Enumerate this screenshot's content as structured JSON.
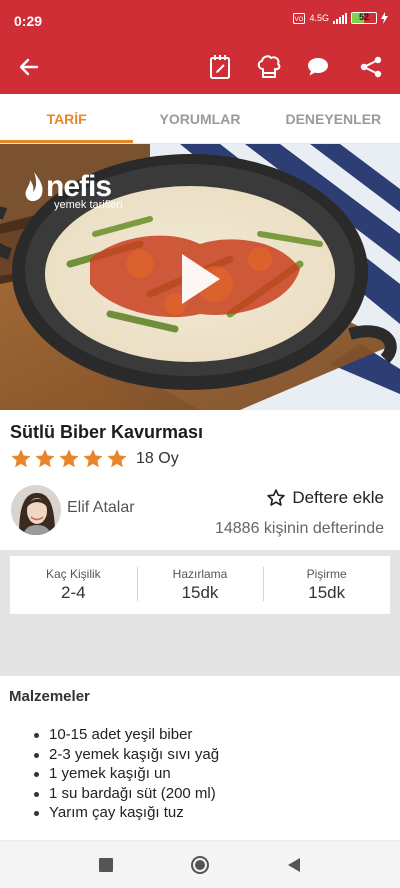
{
  "status_bar": {
    "time": "0:29",
    "network_type": "4.5G",
    "battery_level": "52",
    "battery_fraction": 0.52,
    "icons": [
      "volte-icon",
      "signal-icon",
      "battery-icon",
      "charging-icon"
    ]
  },
  "toolbar": {
    "icons": [
      "back-arrow-icon",
      "notebook-edit-icon",
      "chef-hat-icon",
      "comment-icon",
      "share-icon"
    ],
    "accent_color": "#cf2e36"
  },
  "tabs": [
    {
      "label": "TARİF",
      "active": true
    },
    {
      "label": "YORUMLAR",
      "active": false
    },
    {
      "label": "DENEYENLER",
      "active": false
    }
  ],
  "tab_accent": "#e8862a",
  "video": {
    "logo_text": "nefis",
    "logo_subtext": "yemek tarifleri",
    "play_icon": "play-icon"
  },
  "recipe": {
    "title": "Sütlü Biber Kavurması",
    "rating_stars": 5,
    "rating_count": "18 Oy",
    "star_color": "#e8862a",
    "author": "Elif Atalar",
    "add_to_notebook": "Deftere ekle",
    "notebook_count": "14886 kişinin defterinde"
  },
  "stats": [
    {
      "label": "Kaç Kişilik",
      "value": "2-4"
    },
    {
      "label": "Hazırlama",
      "value": "15dk"
    },
    {
      "label": "Pişirme",
      "value": "15dk"
    }
  ],
  "ingredients": {
    "heading": "Malzemeler",
    "items": [
      "10-15 adet yeşil biber",
      "2-3 yemek kaşığı sıvı yağ",
      "1 yemek kaşığı un",
      "1 su bardağı süt (200 ml)",
      "Yarım çay kaşığı tuz"
    ]
  },
  "nav_bar": {
    "icons": [
      "recents-square-icon",
      "home-circle-icon",
      "back-triangle-icon"
    ]
  }
}
